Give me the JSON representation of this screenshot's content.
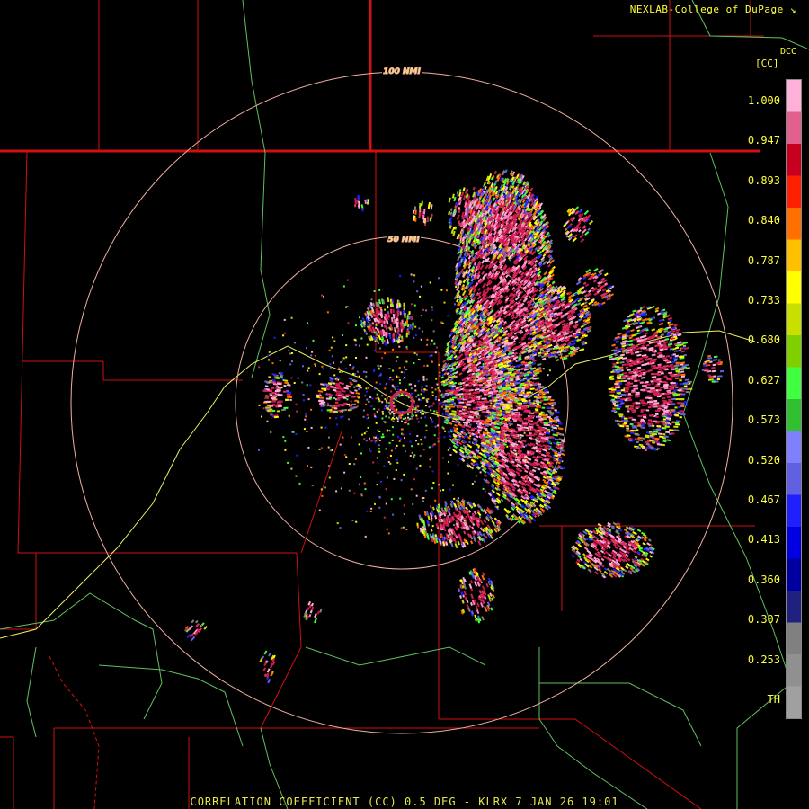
{
  "header": {
    "credit": "NEXLAB-College of DuPage",
    "credit_icon": "arrow-cursor-icon",
    "units": "[CC]",
    "tag": "DCC"
  },
  "rings": [
    {
      "label": "100 NMI"
    },
    {
      "label": "50 NMI"
    }
  ],
  "legend": {
    "labels": [
      "1.000",
      "0.947",
      "0.893",
      "0.840",
      "0.787",
      "0.733",
      "0.680",
      "0.627",
      "0.573",
      "0.520",
      "0.467",
      "0.413",
      "0.360",
      "0.307",
      "0.253",
      "TH"
    ],
    "colors": [
      "#ffb0d8",
      "#e26090",
      "#c80020",
      "#ff2000",
      "#ff7000",
      "#ffc000",
      "#ffff00",
      "#c8e000",
      "#80d000",
      "#40ff40",
      "#30c030",
      "#8080ff",
      "#6060e0",
      "#2020ff",
      "#0000e0",
      "#0000a0",
      "#202080",
      "#808080",
      "#909090",
      "#a0a0a0"
    ]
  },
  "footer": {
    "caption": "CORRELATION COEFFICIENT (CC) 0.5 DEG - KLRX 7 JAN 26 19:01"
  },
  "colors": {
    "boundary": "#d21010",
    "highway": "#60c060",
    "interstate": "#f0f060",
    "ring": "#f0b0a0",
    "text": "#ffff3a"
  }
}
